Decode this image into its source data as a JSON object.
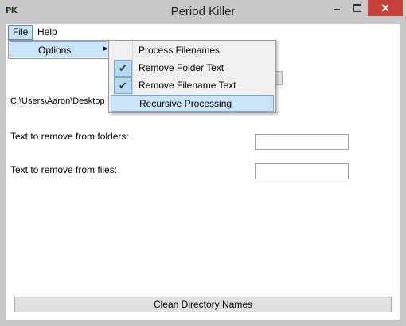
{
  "window": {
    "title": "Period Killer",
    "app_icon_text": "PK",
    "close_glyph": "✕",
    "accent_close": "#c7403a"
  },
  "menubar": {
    "file_label": "File",
    "help_label": "Help"
  },
  "file_menu": {
    "options_label": "Options",
    "submenu_arrow": "▶"
  },
  "options_menu": {
    "items": [
      {
        "label": "Process Filenames",
        "checked": false,
        "highlighted": false
      },
      {
        "label": "Remove Folder Text",
        "checked": true,
        "highlighted": false
      },
      {
        "label": "Remove Filename Text",
        "checked": true,
        "highlighted": false
      },
      {
        "label": "Recursive Processing",
        "checked": false,
        "highlighted": true
      }
    ],
    "check_glyph": "✔"
  },
  "main": {
    "path": "C:\\Users\\Aaron\\Desktop",
    "folder_text_label": "Text to remove from folders:",
    "folder_text_value": "",
    "files_text_label": "Text to remove from files:",
    "files_text_value": "",
    "clean_button_label": "Clean Directory Names"
  }
}
